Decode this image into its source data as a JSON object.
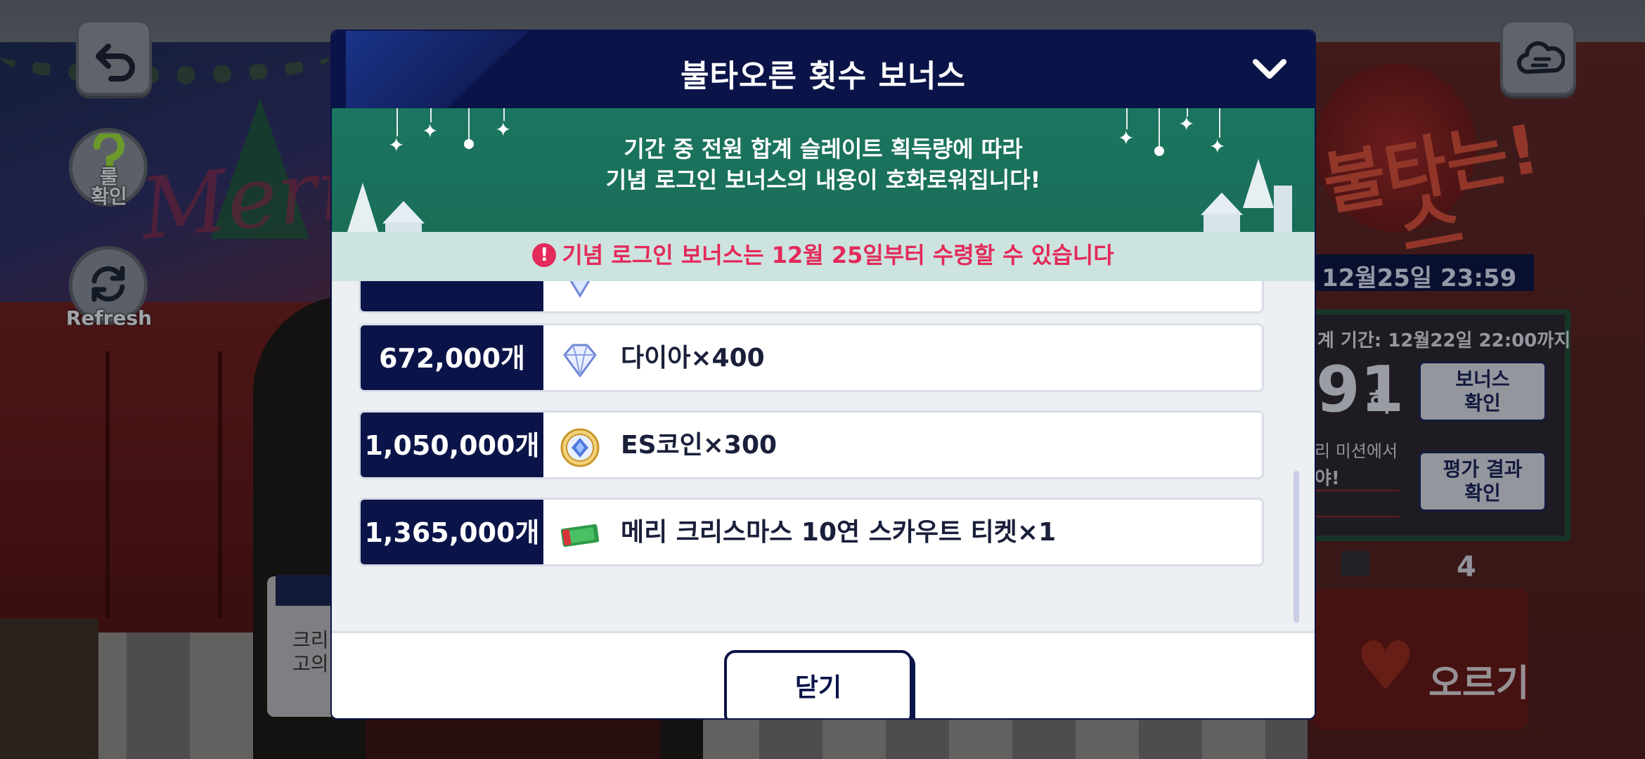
{
  "background": {
    "decor_text": "Merry",
    "event": {
      "decor_title_1": "불타는!",
      "decor_title_2": "스",
      "date_bar": "12월25일 23:59",
      "period": "계 기간: 12월22일 22:00까지",
      "count": "91",
      "count_unit": "회",
      "bonus_button": "보너스\n확인",
      "mission_text": "리 미션에서",
      "mission_sub": "야!",
      "eval_button": "평가 결과\n확인",
      "stage_number": "4",
      "burn_button": "오르기"
    },
    "left_card_text": "크리\n고의"
  },
  "top_left_button": {
    "icon": "back-arrow-icon"
  },
  "top_right_button": {
    "icon": "cloud-menu-icon"
  },
  "side_buttons": [
    {
      "label": "룰\n확인",
      "icon": "question-icon"
    },
    {
      "label": "Refresh",
      "icon": "refresh-icon"
    }
  ],
  "modal": {
    "title": "불타오른 횟수 보너스",
    "collapse_icon": "chevron-down-icon",
    "banner_text_1": "기간 중 전원 합계 슬레이트 획득량에 따라",
    "banner_text_2": "기념 로그인 보너스의 내용이 호화로워집니다!",
    "notice_icon": "!",
    "notice_text": "기념 로그인 보너스는 12월 25일부터 수령할 수 있습니다",
    "rewards": [
      {
        "amount": "",
        "icon": "diamond-icon",
        "label": ""
      },
      {
        "amount": "672,000개",
        "icon": "diamond-icon",
        "label": "다이아×400"
      },
      {
        "amount": "1,050,000개",
        "icon": "es-coin-icon",
        "label": "ES코인×300"
      },
      {
        "amount": "1,365,000개",
        "icon": "scout-ticket-icon",
        "label": "메리 크리스마스 10연 스카우트 티켓×1"
      }
    ],
    "close_label": "닫기"
  },
  "colors": {
    "navy": "#0b1448",
    "green_banner": "#1b7560",
    "notice_red": "#e32a5a",
    "notice_bg": "#cde3df"
  }
}
